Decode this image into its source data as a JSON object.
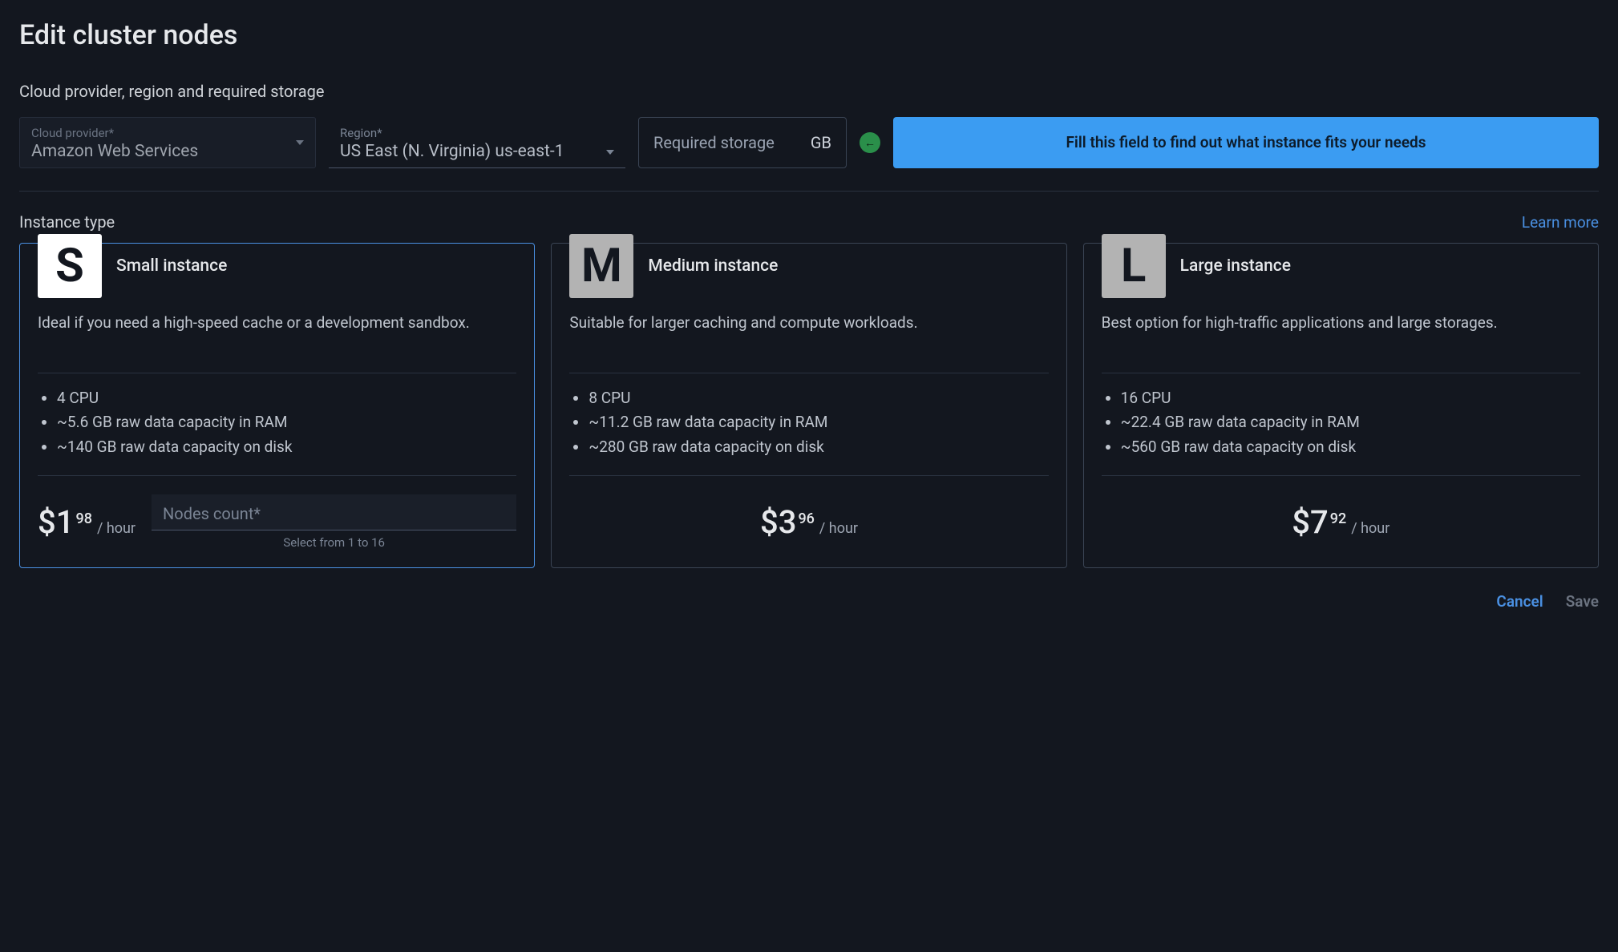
{
  "title": "Edit cluster nodes",
  "section_label": "Cloud provider, region and required storage",
  "provider": {
    "label": "Cloud provider*",
    "value": "Amazon Web Services"
  },
  "region": {
    "label": "Region*",
    "value": "US East (N. Virginia) us-east-1"
  },
  "storage": {
    "label": "Required storage",
    "unit": "GB"
  },
  "banner": "Fill this field to find out what instance fits your needs",
  "instance_section": {
    "title": "Instance type",
    "learn_more": "Learn more"
  },
  "cards": [
    {
      "badge": "S",
      "name": "Small instance",
      "desc": "Ideal if you need a high-speed cache or a development sandbox.",
      "specs": [
        "4 CPU",
        "~5.6 GB raw data capacity in RAM",
        "~140 GB raw data capacity on disk"
      ],
      "price_main": "$1",
      "price_cents": "98",
      "price_unit": "/ hour",
      "selected": true,
      "nodes": {
        "placeholder": "Nodes count*",
        "helper": "Select from 1 to 16"
      }
    },
    {
      "badge": "M",
      "name": "Medium instance",
      "desc": "Suitable for larger caching and compute workloads.",
      "specs": [
        "8 CPU",
        "~11.2 GB raw data capacity in RAM",
        "~280 GB raw data capacity on disk"
      ],
      "price_main": "$3",
      "price_cents": "96",
      "price_unit": "/ hour",
      "selected": false
    },
    {
      "badge": "L",
      "name": "Large instance",
      "desc": "Best option for high-traffic applications and large storages.",
      "specs": [
        "16 CPU",
        "~22.4 GB raw data capacity in RAM",
        "~560 GB raw data capacity on disk"
      ],
      "price_main": "$7",
      "price_cents": "92",
      "price_unit": "/ hour",
      "selected": false
    }
  ],
  "actions": {
    "cancel": "Cancel",
    "save": "Save"
  }
}
